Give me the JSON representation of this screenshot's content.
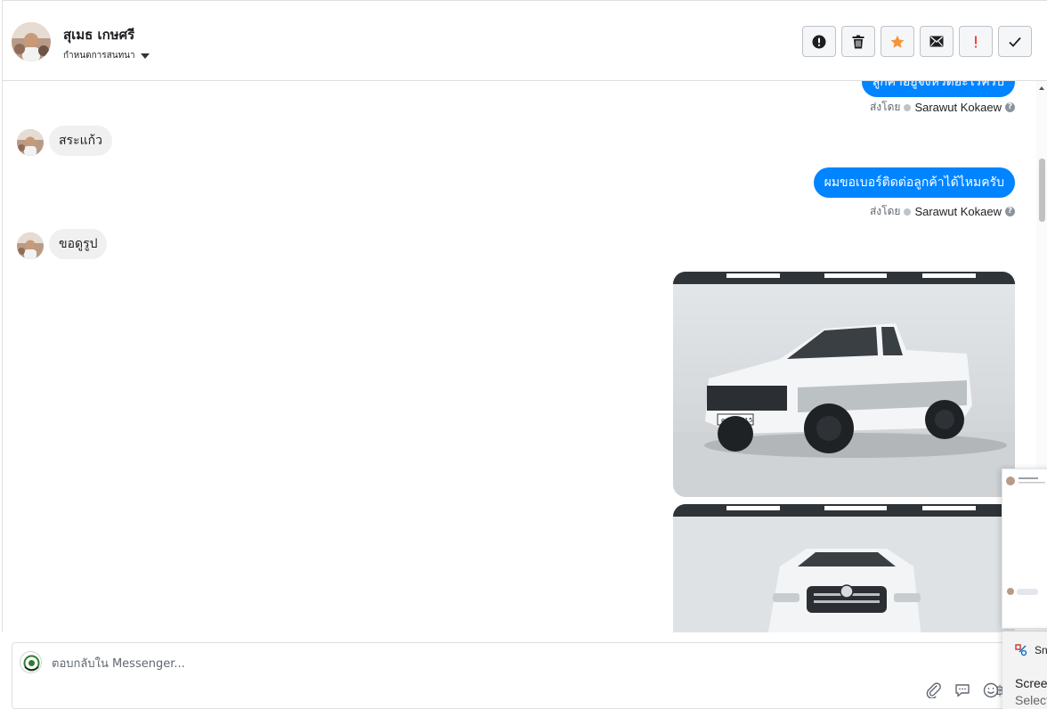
{
  "header": {
    "contact_name": "สุเมธ เกษศรี",
    "assign_label": "กำหนดการสนทนา",
    "actions": [
      {
        "icon": "alert-circle-icon",
        "name": "mark-spam-button"
      },
      {
        "icon": "trash-icon",
        "name": "delete-button"
      },
      {
        "icon": "star-icon",
        "name": "star-button",
        "color": "#f7923b"
      },
      {
        "icon": "envelope-icon",
        "name": "mark-unread-button"
      },
      {
        "icon": "exclamation-icon",
        "name": "follow-up-button",
        "color": "#fa3e3e"
      },
      {
        "icon": "checkmark-icon",
        "name": "mark-done-button"
      }
    ]
  },
  "conversation": {
    "messages": [
      {
        "type": "outgoing-partial",
        "text": "ลูกค้าอยู่จังหวัดอะไรครับ"
      },
      {
        "type": "sent-by",
        "prefix": "ส่งโดย",
        "agent": "Sarawut Kokaew"
      },
      {
        "type": "incoming",
        "text": "สระแก้ว"
      },
      {
        "type": "outgoing",
        "text": "ผมขอเบอร์ติดต่อลูกค้าได้ไหมครับ"
      },
      {
        "type": "sent-by",
        "prefix": "ส่งโดย",
        "agent": "Sarawut Kokaew"
      },
      {
        "type": "incoming",
        "text": "ขอดูรูป"
      },
      {
        "type": "photo",
        "alt": "white-pickup-truck-side"
      },
      {
        "type": "photo",
        "alt": "white-pickup-truck-front"
      }
    ],
    "plate_text": "ฒท4 3515"
  },
  "composer": {
    "placeholder": "ตอบกลับใน Messenger...",
    "tools": [
      "paperclip-icon",
      "speech-bubble-icon",
      "emoji-icon",
      "baht-icon"
    ],
    "baht_symbol": "฿"
  },
  "snip_popup": {
    "app_name": "Sn",
    "title": "Screen",
    "subtitle": "Select"
  },
  "colors": {
    "brand_blue": "#0084ff",
    "incoming_bubble": "#f1f0f0",
    "star": "#f7923b",
    "flag_red": "#fa3e3e"
  }
}
